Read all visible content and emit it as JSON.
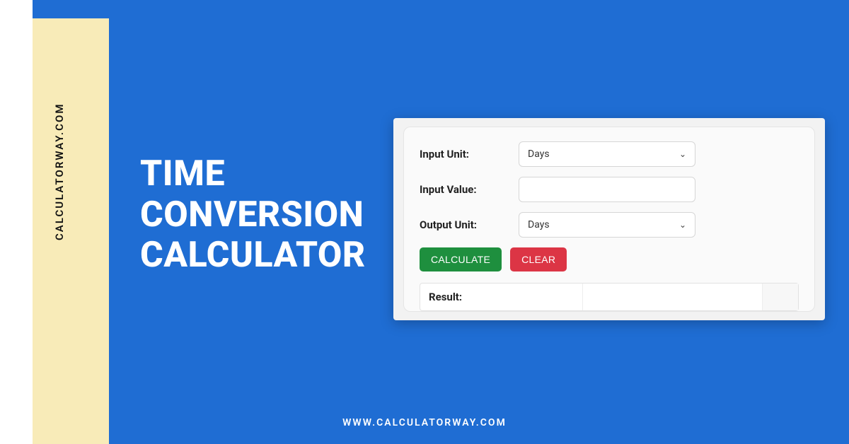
{
  "brand": {
    "vertical_label": "CALCULATORWAY.COM",
    "footer_url": "WWW.CALCULATORWAY.COM"
  },
  "title": {
    "line1": "TIME",
    "line2": "CONVERSION",
    "line3": "CALCULATOR"
  },
  "form": {
    "input_unit_label": "Input Unit:",
    "input_unit_value": "Days",
    "input_value_label": "Input Value:",
    "input_value_value": "",
    "output_unit_label": "Output Unit:",
    "output_unit_value": "Days"
  },
  "buttons": {
    "calculate": "CALCULATE",
    "clear": "CLEAR"
  },
  "result": {
    "label": "Result:",
    "value": "",
    "unit": ""
  },
  "colors": {
    "bg": "#1f6dd3",
    "cream": "#f8ebb8",
    "calc_green": "#1e8f3e",
    "clear_red": "#dc3545"
  }
}
